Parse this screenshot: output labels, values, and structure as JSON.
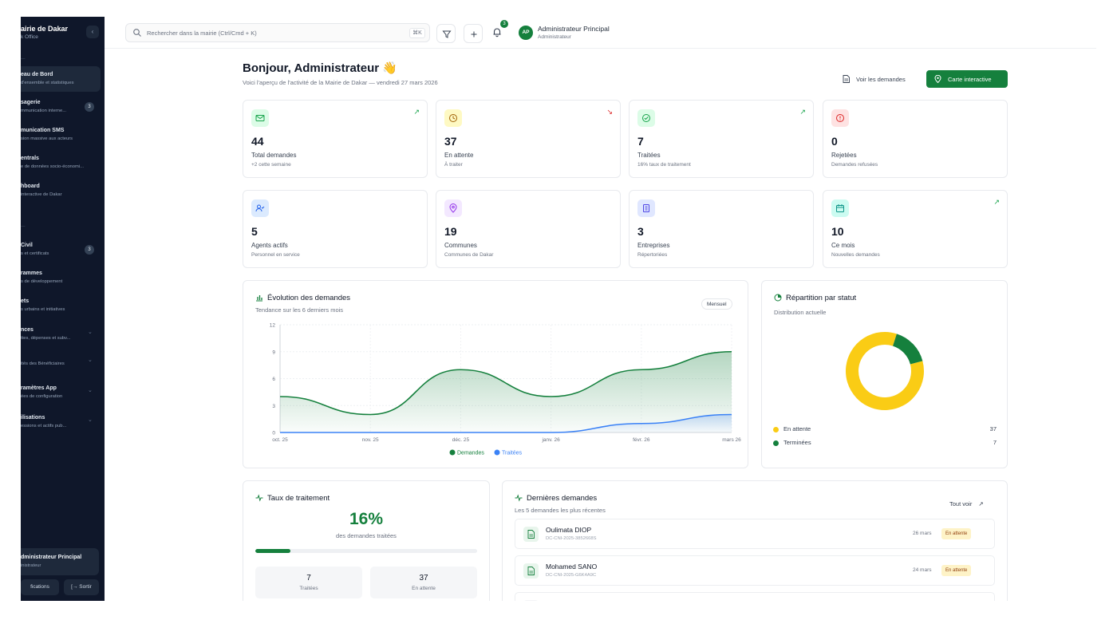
{
  "sidebar": {
    "brand_title": "airie de Dakar",
    "brand_sub": "k Office",
    "collapse_icon": "chevron-left-icon",
    "sections": [
      "...",
      "...",
      "..."
    ],
    "items": [
      {
        "title": "eau de Bord",
        "sub": "d'ensemble et statistiques",
        "active": true
      },
      {
        "title": "sagerie",
        "sub": "mmunication interne...",
        "badge": "3"
      },
      {
        "title": "munication SMS",
        "sub": "sion massive aux acteurs"
      },
      {
        "title": "entrals",
        "sub": "e de données socio-économi..."
      },
      {
        "title": "hboard",
        "sub": "interactive de Dakar"
      },
      {
        "title": "Civil",
        "sub": "s et certificats",
        "badge": "3"
      },
      {
        "title": "rammes",
        "sub": "s de développement"
      },
      {
        "title": "ets",
        "sub": "s urbains et initiatives"
      },
      {
        "title": "nces",
        "sub": "ttes, dépenses et subv...",
        "chevron": true
      },
      {
        "title": "",
        "sub": "ités des Bénéficiaires",
        "chevron": true
      },
      {
        "title": "ramètres App",
        "sub": "ées de configuration",
        "chevron": true
      },
      {
        "title": "ilisations",
        "sub": "essions et actifs pub...",
        "chevron": true
      }
    ],
    "user_name": "dministrateur Principal",
    "user_role": "inistrateur",
    "btn_notifications": "fications",
    "btn_logout": "[→ Sortir"
  },
  "topbar": {
    "search_placeholder": "Rechercher dans la mairie (Ctrl/Cmd + K)",
    "search_kbd": "⌘K",
    "notif_count": "3",
    "avatar_initials": "AP",
    "user_name": "Administrateur Principal",
    "user_role": "Administrateur"
  },
  "header": {
    "greeting": "Bonjour, Administrateur 👋",
    "subtitle": "Voici l'aperçu de l'activité de la Mairie de Dakar — vendredi 27 mars 2026",
    "btn_requests": "Voir les demandes",
    "btn_map": "Carte interactive"
  },
  "stats": [
    {
      "value": "44",
      "label": "Total demandes",
      "sub": "+2 cette semaine",
      "trend": "↗",
      "trend_color": "#16a34a",
      "icon": "inbox-icon",
      "icon_bg": "#dcfce7",
      "icon_color": "#16a34a"
    },
    {
      "value": "37",
      "label": "En attente",
      "sub": "À traiter",
      "trend": "↘",
      "trend_color": "#dc2626",
      "icon": "clock-icon",
      "icon_bg": "#fef9c3",
      "icon_color": "#a16207"
    },
    {
      "value": "7",
      "label": "Traitées",
      "sub": "16% taux de traitement",
      "trend": "↗",
      "trend_color": "#16a34a",
      "icon": "check-circle-icon",
      "icon_bg": "#dcfce7",
      "icon_color": "#16a34a"
    },
    {
      "value": "0",
      "label": "Rejetées",
      "sub": "Demandes refusées",
      "trend": "",
      "trend_color": "#16a34a",
      "icon": "alert-circle-icon",
      "icon_bg": "#fee2e2",
      "icon_color": "#dc2626"
    },
    {
      "value": "5",
      "label": "Agents actifs",
      "sub": "Personnel en service",
      "trend": "",
      "trend_color": "#16a34a",
      "icon": "user-check-icon",
      "icon_bg": "#dbeafe",
      "icon_color": "#2563eb"
    },
    {
      "value": "19",
      "label": "Communes",
      "sub": "Communes de Dakar",
      "trend": "",
      "trend_color": "#16a34a",
      "icon": "map-pin-icon",
      "icon_bg": "#f3e8ff",
      "icon_color": "#9333ea"
    },
    {
      "value": "3",
      "label": "Entreprises",
      "sub": "Répertoriées",
      "trend": "",
      "trend_color": "#16a34a",
      "icon": "building-icon",
      "icon_bg": "#e0e7ff",
      "icon_color": "#4f46e5"
    },
    {
      "value": "10",
      "label": "Ce mois",
      "sub": "Nouvelles demandes",
      "trend": "↗",
      "trend_color": "#16a34a",
      "icon": "calendar-icon",
      "icon_bg": "#ccfbf1",
      "icon_color": "#0d9488"
    }
  ],
  "evolution": {
    "title": "Évolution des demandes",
    "subtitle": "Tendance sur les 6 derniers mois",
    "chip": "Mensuel",
    "chart_data": {
      "type": "area",
      "categories": [
        "oct. 25",
        "nov. 25",
        "déc. 25",
        "janv. 26",
        "févr. 26",
        "mars 26"
      ],
      "ylim": [
        0,
        12
      ],
      "yticks": [
        "0",
        "3",
        "6",
        "9",
        "12"
      ],
      "series": [
        {
          "name": "Demandes",
          "values": [
            4,
            2,
            7,
            4,
            7,
            9
          ],
          "color": "#15803d"
        },
        {
          "name": "Traitées",
          "values": [
            0,
            0,
            0,
            0,
            1,
            2
          ],
          "color": "#3b82f6"
        }
      ]
    }
  },
  "distribution": {
    "title": "Répartition par statut",
    "subtitle": "Distribution actuelle",
    "chart_data": {
      "type": "pie",
      "labels": [
        "En attente",
        "Terminées"
      ],
      "values": [
        37,
        7
      ],
      "colors": [
        "#facc15",
        "#15803d"
      ]
    }
  },
  "rate": {
    "title": "Taux de traitement",
    "value": "16%",
    "progress": 0.16,
    "subtitle": "des demandes traitées",
    "treated_value": "7",
    "treated_label": "Traitées",
    "pending_value": "37",
    "pending_label": "En attente"
  },
  "latest": {
    "title": "Dernières demandes",
    "subtitle": "Les 5 demandes les plus récentes",
    "see_all": "Tout voir",
    "items": [
      {
        "name": "Oulimata DIOP",
        "code": "DC-CNI-2025-3852668S",
        "date": "26 mars",
        "status": "En attente"
      },
      {
        "name": "Mohamed SANO",
        "code": "DC-CNI-2025-G6K4A9C",
        "date": "24 mars",
        "status": "En attente"
      }
    ]
  }
}
